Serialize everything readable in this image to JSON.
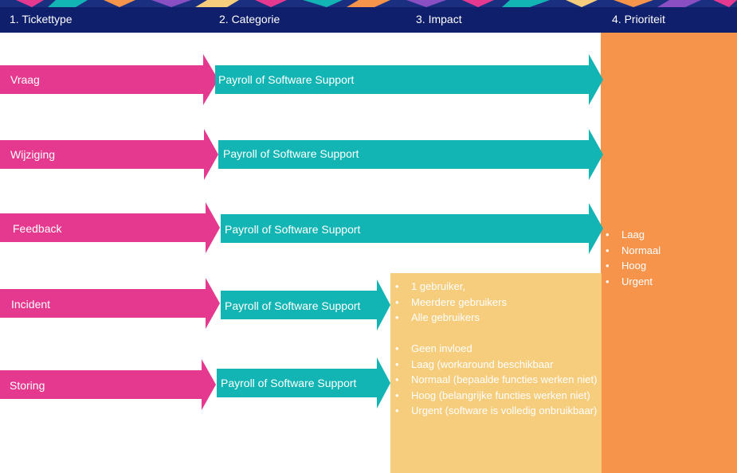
{
  "header": {
    "col1": "1. Tickettype",
    "col2": "2. Categorie",
    "col3": "3. Impact",
    "col4": "4. Prioriteit"
  },
  "rows": [
    {
      "type": "Vraag",
      "category": "Payroll of Software Support"
    },
    {
      "type": "Wijziging",
      "category": "Payroll of Software Support"
    },
    {
      "type": "Feedback",
      "category": "Payroll of Software Support"
    },
    {
      "type": "Incident",
      "category": "Payroll of Software Support"
    },
    {
      "type": "Storing",
      "category": "Payroll of Software Support"
    }
  ],
  "impact": {
    "scope": [
      "1 gebruiker,",
      "Meerdere gebruikers",
      "Alle gebruikers"
    ],
    "levels": [
      "Geen invloed",
      "Laag (workaround beschikbaar",
      "Normaal (bepaalde functies werken niet)",
      "Hoog (belangrijke functies werken niet)",
      "Urgent (software is volledig onbruikbaar)"
    ]
  },
  "priority": [
    "Laag",
    "Normaal",
    "Hoog",
    "Urgent"
  ],
  "colors": {
    "header": "#0f1f6b",
    "tickettype_arrow": "#e5398f",
    "category_arrow": "#12b5b4",
    "impact_box": "#f5cd7d",
    "priority_box": "#f7944c"
  }
}
